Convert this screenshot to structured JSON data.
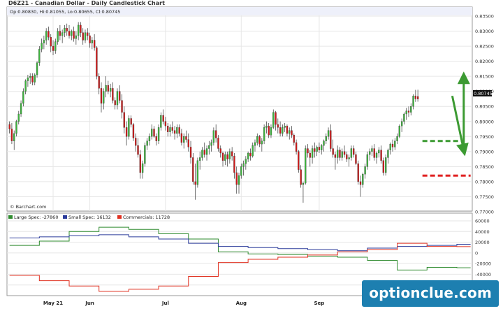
{
  "chart_data": {
    "type": "candlestick",
    "title": "D6Z21 - Canadian Dollar - Daily Candlestick Chart",
    "ohlc_label": "Op:0.80830, Hi:0.81055, Lo:0.80655, Cl:0.80745",
    "last_price_label": "0.80745",
    "attribution": "© Barchart.com",
    "x_labels": [
      "May 21",
      "Jun",
      "Jul",
      "Aug",
      "Sep"
    ],
    "x_label_days": [
      19,
      35,
      68,
      101,
      135
    ],
    "day_count": 201,
    "price_ylim": [
      0.77,
      0.835
    ],
    "price_ticks": [
      "0.83500",
      "0.83000",
      "0.82500",
      "0.82000",
      "0.81500",
      "0.81000",
      "0.80500",
      "0.80000",
      "0.79500",
      "0.79000",
      "0.78500",
      "0.78000",
      "0.77500",
      "0.77000"
    ],
    "candles": [
      [
        0.799,
        0.8,
        0.796,
        0.7975
      ],
      [
        0.7975,
        0.7995,
        0.7925,
        0.7935
      ],
      [
        0.7935,
        0.797,
        0.7905,
        0.796
      ],
      [
        0.796,
        0.8005,
        0.795,
        0.8
      ],
      [
        0.8,
        0.8035,
        0.799,
        0.8025
      ],
      [
        0.8025,
        0.807,
        0.8015,
        0.806
      ],
      [
        0.806,
        0.811,
        0.805,
        0.81
      ],
      [
        0.81,
        0.814,
        0.809,
        0.8135
      ],
      [
        0.8135,
        0.8155,
        0.8115,
        0.8145
      ],
      [
        0.8145,
        0.816,
        0.8125,
        0.815
      ],
      [
        0.815,
        0.816,
        0.812,
        0.813
      ],
      [
        0.813,
        0.816,
        0.812,
        0.8155
      ],
      [
        0.8155,
        0.82,
        0.8145,
        0.8195
      ],
      [
        0.8195,
        0.825,
        0.8185,
        0.824
      ],
      [
        0.824,
        0.8275,
        0.823,
        0.826
      ],
      [
        0.826,
        0.8285,
        0.824,
        0.827
      ],
      [
        0.827,
        0.831,
        0.8255,
        0.83
      ],
      [
        0.83,
        0.8315,
        0.827,
        0.828
      ],
      [
        0.828,
        0.829,
        0.823,
        0.825
      ],
      [
        0.825,
        0.827,
        0.822,
        0.8235
      ],
      [
        0.8235,
        0.8275,
        0.8225,
        0.8265
      ],
      [
        0.8265,
        0.831,
        0.8255,
        0.83
      ],
      [
        0.83,
        0.832,
        0.827,
        0.8285
      ],
      [
        0.8285,
        0.8305,
        0.826,
        0.8295
      ],
      [
        0.8295,
        0.832,
        0.828,
        0.831
      ],
      [
        0.831,
        0.8325,
        0.8285,
        0.83
      ],
      [
        0.83,
        0.832,
        0.8275,
        0.8285
      ],
      [
        0.8285,
        0.8305,
        0.827,
        0.83
      ],
      [
        0.83,
        0.8315,
        0.8265,
        0.8275
      ],
      [
        0.8275,
        0.83,
        0.8255,
        0.8285
      ],
      [
        0.8285,
        0.833,
        0.827,
        0.832
      ],
      [
        0.832,
        0.833,
        0.828,
        0.8295
      ],
      [
        0.8295,
        0.831,
        0.8255,
        0.827
      ],
      [
        0.827,
        0.8305,
        0.826,
        0.8295
      ],
      [
        0.8295,
        0.831,
        0.827,
        0.8285
      ],
      [
        0.8285,
        0.8295,
        0.8245,
        0.826
      ],
      [
        0.826,
        0.828,
        0.824,
        0.827
      ],
      [
        0.827,
        0.829,
        0.8235,
        0.8245
      ],
      [
        0.8245,
        0.825,
        0.814,
        0.815
      ],
      [
        0.815,
        0.816,
        0.809,
        0.811
      ],
      [
        0.811,
        0.813,
        0.803,
        0.806
      ],
      [
        0.806,
        0.811,
        0.804,
        0.81
      ],
      [
        0.81,
        0.815,
        0.808,
        0.812
      ],
      [
        0.812,
        0.8135,
        0.809,
        0.81
      ],
      [
        0.81,
        0.8125,
        0.808,
        0.811
      ],
      [
        0.811,
        0.813,
        0.806,
        0.807
      ],
      [
        0.807,
        0.808,
        0.804,
        0.8055
      ],
      [
        0.8055,
        0.811,
        0.804,
        0.81
      ],
      [
        0.81,
        0.812,
        0.806,
        0.807
      ],
      [
        0.807,
        0.809,
        0.801,
        0.803
      ],
      [
        0.803,
        0.805,
        0.796,
        0.798
      ],
      [
        0.798,
        0.8,
        0.792,
        0.795
      ],
      [
        0.795,
        0.802,
        0.794,
        0.801
      ],
      [
        0.801,
        0.802,
        0.798,
        0.799
      ],
      [
        0.799,
        0.7995,
        0.7935,
        0.7945
      ],
      [
        0.7945,
        0.796,
        0.79,
        0.792
      ],
      [
        0.792,
        0.7945,
        0.788,
        0.789
      ],
      [
        0.789,
        0.7905,
        0.781,
        0.783
      ],
      [
        0.783,
        0.787,
        0.781,
        0.786
      ],
      [
        0.786,
        0.793,
        0.785,
        0.792
      ],
      [
        0.792,
        0.7945,
        0.7905,
        0.7935
      ],
      [
        0.7935,
        0.796,
        0.792,
        0.795
      ],
      [
        0.795,
        0.799,
        0.794,
        0.7975
      ],
      [
        0.7975,
        0.7985,
        0.7945,
        0.795
      ],
      [
        0.795,
        0.796,
        0.792,
        0.7935
      ],
      [
        0.7935,
        0.799,
        0.7925,
        0.798
      ],
      [
        0.798,
        0.803,
        0.797,
        0.802
      ],
      [
        0.802,
        0.804,
        0.799,
        0.8
      ],
      [
        0.8,
        0.8015,
        0.797,
        0.7985
      ],
      [
        0.7985,
        0.7995,
        0.795,
        0.7965
      ],
      [
        0.7965,
        0.799,
        0.795,
        0.798
      ],
      [
        0.798,
        0.8,
        0.796,
        0.797
      ],
      [
        0.797,
        0.7985,
        0.794,
        0.796
      ],
      [
        0.796,
        0.799,
        0.7945,
        0.798
      ],
      [
        0.798,
        0.799,
        0.795,
        0.796
      ],
      [
        0.796,
        0.7975,
        0.792,
        0.793
      ],
      [
        0.793,
        0.796,
        0.791,
        0.795
      ],
      [
        0.795,
        0.797,
        0.793,
        0.794
      ],
      [
        0.794,
        0.796,
        0.79,
        0.7915
      ],
      [
        0.7915,
        0.7935,
        0.786,
        0.788
      ],
      [
        0.788,
        0.7895,
        0.779,
        0.78
      ],
      [
        0.78,
        0.786,
        0.774,
        0.779
      ],
      [
        0.779,
        0.788,
        0.778,
        0.787
      ],
      [
        0.787,
        0.79,
        0.784,
        0.788
      ],
      [
        0.788,
        0.7915,
        0.787,
        0.7905
      ],
      [
        0.7905,
        0.793,
        0.788,
        0.789
      ],
      [
        0.789,
        0.792,
        0.787,
        0.791
      ],
      [
        0.791,
        0.7935,
        0.789,
        0.792
      ],
      [
        0.792,
        0.794,
        0.79,
        0.793
      ],
      [
        0.793,
        0.798,
        0.792,
        0.797
      ],
      [
        0.797,
        0.799,
        0.793,
        0.7945
      ],
      [
        0.7945,
        0.7955,
        0.79,
        0.791
      ],
      [
        0.791,
        0.792,
        0.788,
        0.7895
      ],
      [
        0.7895,
        0.79,
        0.785,
        0.787
      ],
      [
        0.787,
        0.79,
        0.7855,
        0.789
      ],
      [
        0.789,
        0.79,
        0.785,
        0.7875
      ],
      [
        0.7875,
        0.791,
        0.786,
        0.79
      ],
      [
        0.79,
        0.7915,
        0.787,
        0.7885
      ],
      [
        0.7885,
        0.7895,
        0.781,
        0.783
      ],
      [
        0.783,
        0.785,
        0.776,
        0.779
      ],
      [
        0.779,
        0.783,
        0.776,
        0.782
      ],
      [
        0.782,
        0.786,
        0.781,
        0.785
      ],
      [
        0.785,
        0.787,
        0.782,
        0.786
      ],
      [
        0.786,
        0.7885,
        0.784,
        0.7875
      ],
      [
        0.7875,
        0.79,
        0.7865,
        0.7895
      ],
      [
        0.7895,
        0.791,
        0.787,
        0.7885
      ],
      [
        0.7885,
        0.793,
        0.788,
        0.792
      ],
      [
        0.792,
        0.794,
        0.79,
        0.793
      ],
      [
        0.793,
        0.796,
        0.792,
        0.795
      ],
      [
        0.795,
        0.7955,
        0.7915,
        0.7925
      ],
      [
        0.7925,
        0.7945,
        0.79,
        0.7935
      ],
      [
        0.7935,
        0.799,
        0.7925,
        0.798
      ],
      [
        0.798,
        0.8,
        0.796,
        0.7985
      ],
      [
        0.7985,
        0.7995,
        0.7945,
        0.7955
      ],
      [
        0.7955,
        0.799,
        0.7945,
        0.798
      ],
      [
        0.798,
        0.804,
        0.7975,
        0.803
      ],
      [
        0.803,
        0.8035,
        0.797,
        0.799
      ],
      [
        0.799,
        0.801,
        0.796,
        0.798
      ],
      [
        0.798,
        0.8,
        0.795,
        0.796
      ],
      [
        0.796,
        0.799,
        0.795,
        0.798
      ],
      [
        0.798,
        0.7995,
        0.7965,
        0.7985
      ],
      [
        0.7985,
        0.799,
        0.795,
        0.796
      ],
      [
        0.796,
        0.798,
        0.794,
        0.797
      ],
      [
        0.797,
        0.7985,
        0.7945,
        0.7955
      ],
      [
        0.7955,
        0.796,
        0.792,
        0.793
      ],
      [
        0.793,
        0.794,
        0.789,
        0.79
      ],
      [
        0.79,
        0.7905,
        0.783,
        0.784
      ],
      [
        0.784,
        0.7855,
        0.778,
        0.779
      ],
      [
        0.779,
        0.78,
        0.773,
        0.7795
      ],
      [
        0.7795,
        0.792,
        0.779,
        0.791
      ],
      [
        0.791,
        0.7925,
        0.788,
        0.7895
      ],
      [
        0.7895,
        0.7905,
        0.785,
        0.788
      ],
      [
        0.788,
        0.792,
        0.786,
        0.791
      ],
      [
        0.791,
        0.793,
        0.788,
        0.79
      ],
      [
        0.79,
        0.792,
        0.7885,
        0.7915
      ],
      [
        0.7915,
        0.793,
        0.7895,
        0.7905
      ],
      [
        0.7905,
        0.7925,
        0.789,
        0.792
      ],
      [
        0.792,
        0.794,
        0.79,
        0.7935
      ],
      [
        0.7935,
        0.796,
        0.7925,
        0.795
      ],
      [
        0.795,
        0.798,
        0.794,
        0.797
      ],
      [
        0.797,
        0.799,
        0.79,
        0.791
      ],
      [
        0.791,
        0.794,
        0.788,
        0.789
      ],
      [
        0.789,
        0.79,
        0.784,
        0.788
      ],
      [
        0.788,
        0.792,
        0.786,
        0.7905
      ],
      [
        0.7905,
        0.7915,
        0.787,
        0.788
      ],
      [
        0.788,
        0.791,
        0.787,
        0.79
      ],
      [
        0.79,
        0.792,
        0.788,
        0.789
      ],
      [
        0.789,
        0.79,
        0.7865,
        0.7875
      ],
      [
        0.7875,
        0.789,
        0.785,
        0.788
      ],
      [
        0.788,
        0.792,
        0.787,
        0.791
      ],
      [
        0.791,
        0.792,
        0.788,
        0.789
      ],
      [
        0.789,
        0.79,
        0.7855,
        0.786
      ],
      [
        0.786,
        0.787,
        0.779,
        0.78
      ],
      [
        0.78,
        0.782,
        0.775,
        0.779
      ],
      [
        0.779,
        0.783,
        0.778,
        0.7825
      ],
      [
        0.7825,
        0.786,
        0.781,
        0.785
      ],
      [
        0.785,
        0.79,
        0.784,
        0.789
      ],
      [
        0.789,
        0.791,
        0.787,
        0.79
      ],
      [
        0.79,
        0.792,
        0.7885,
        0.791
      ],
      [
        0.791,
        0.7925,
        0.787,
        0.788
      ],
      [
        0.788,
        0.79,
        0.786,
        0.7895
      ],
      [
        0.7895,
        0.7915,
        0.788,
        0.7905
      ],
      [
        0.7905,
        0.792,
        0.786,
        0.787
      ],
      [
        0.787,
        0.788,
        0.782,
        0.783
      ],
      [
        0.783,
        0.789,
        0.782,
        0.788
      ],
      [
        0.788,
        0.791,
        0.786,
        0.7905
      ],
      [
        0.7905,
        0.793,
        0.789,
        0.7925
      ],
      [
        0.7925,
        0.794,
        0.79,
        0.7915
      ],
      [
        0.7915,
        0.7945,
        0.7905,
        0.7935
      ],
      [
        0.7935,
        0.796,
        0.7925,
        0.795
      ],
      [
        0.795,
        0.799,
        0.7945,
        0.7985
      ],
      [
        0.7985,
        0.801,
        0.7965,
        0.8
      ],
      [
        0.8,
        0.803,
        0.799,
        0.8025
      ],
      [
        0.8025,
        0.8045,
        0.8005,
        0.8035
      ],
      [
        0.8035,
        0.805,
        0.8015,
        0.803
      ],
      [
        0.803,
        0.806,
        0.802,
        0.805
      ],
      [
        0.805,
        0.809,
        0.804,
        0.8085
      ],
      [
        0.8085,
        0.8105,
        0.8065,
        0.8075
      ],
      [
        0.8083,
        0.81055,
        0.80655,
        0.80745
      ]
    ],
    "cot_ylim": [
      -80000,
      60000
    ],
    "cot_ticks": [
      60000,
      40000,
      20000,
      0,
      -20000,
      -40000,
      -60000
    ],
    "cot_tick_labels": [
      "60000",
      "40000",
      "20000",
      "0",
      "-20000",
      "-40000",
      "-60000"
    ],
    "cot_series": [
      {
        "name": "Large Spec: -27860",
        "color": "#2e8b2e",
        "days": [
          0,
          13,
          26,
          39,
          52,
          65,
          78,
          91,
          104,
          117,
          130,
          143,
          156,
          169,
          182,
          195,
          201
        ],
        "values": [
          14000,
          22000,
          40000,
          48000,
          44000,
          36000,
          26000,
          2000,
          -2000,
          -3000,
          -6000,
          -8000,
          -14000,
          -32000,
          -27000,
          -27860,
          -27860
        ]
      },
      {
        "name": "Small Spec: 16132",
        "color": "#2a3a9a",
        "days": [
          0,
          13,
          26,
          39,
          52,
          65,
          78,
          91,
          104,
          117,
          130,
          143,
          156,
          169,
          182,
          195,
          201
        ],
        "values": [
          28000,
          30000,
          32000,
          34000,
          30000,
          26000,
          18000,
          12000,
          10000,
          8000,
          6000,
          4000,
          9000,
          12000,
          14000,
          16132,
          16132
        ]
      },
      {
        "name": "Commercials: 11728",
        "color": "#e03020",
        "days": [
          0,
          13,
          26,
          39,
          52,
          65,
          78,
          91,
          104,
          117,
          130,
          143,
          156,
          169,
          182,
          195,
          201
        ],
        "values": [
          -42000,
          -52000,
          -62000,
          -72000,
          -68000,
          -62000,
          -44000,
          -18000,
          -12000,
          -8000,
          -4000,
          2000,
          6000,
          18000,
          12000,
          11728,
          11728
        ]
      }
    ],
    "annotations": [
      {
        "type": "arrow",
        "color": "#3c9a32",
        "dashed": false,
        "from": [
          198,
          0.79
        ],
        "to": [
          198,
          0.8145
        ]
      },
      {
        "type": "arrow",
        "color": "#3c9a32",
        "dashed": false,
        "from": [
          193,
          0.8085
        ],
        "to": [
          198,
          0.7905
        ]
      },
      {
        "type": "dashed-line",
        "color": "#3c9a32",
        "from": [
          180,
          0.7935
        ],
        "to": [
          197,
          0.7935
        ]
      },
      {
        "type": "dashed-line",
        "color": "#e02020",
        "from": [
          180,
          0.782
        ],
        "to": [
          201,
          0.782
        ]
      },
      {
        "type": "cot-arrow",
        "color": "#3c9a32",
        "from": [
          181,
          2000
        ],
        "to": [
          198,
          -15000
        ]
      }
    ]
  },
  "branding": {
    "logo_text": "optionclue.com"
  }
}
